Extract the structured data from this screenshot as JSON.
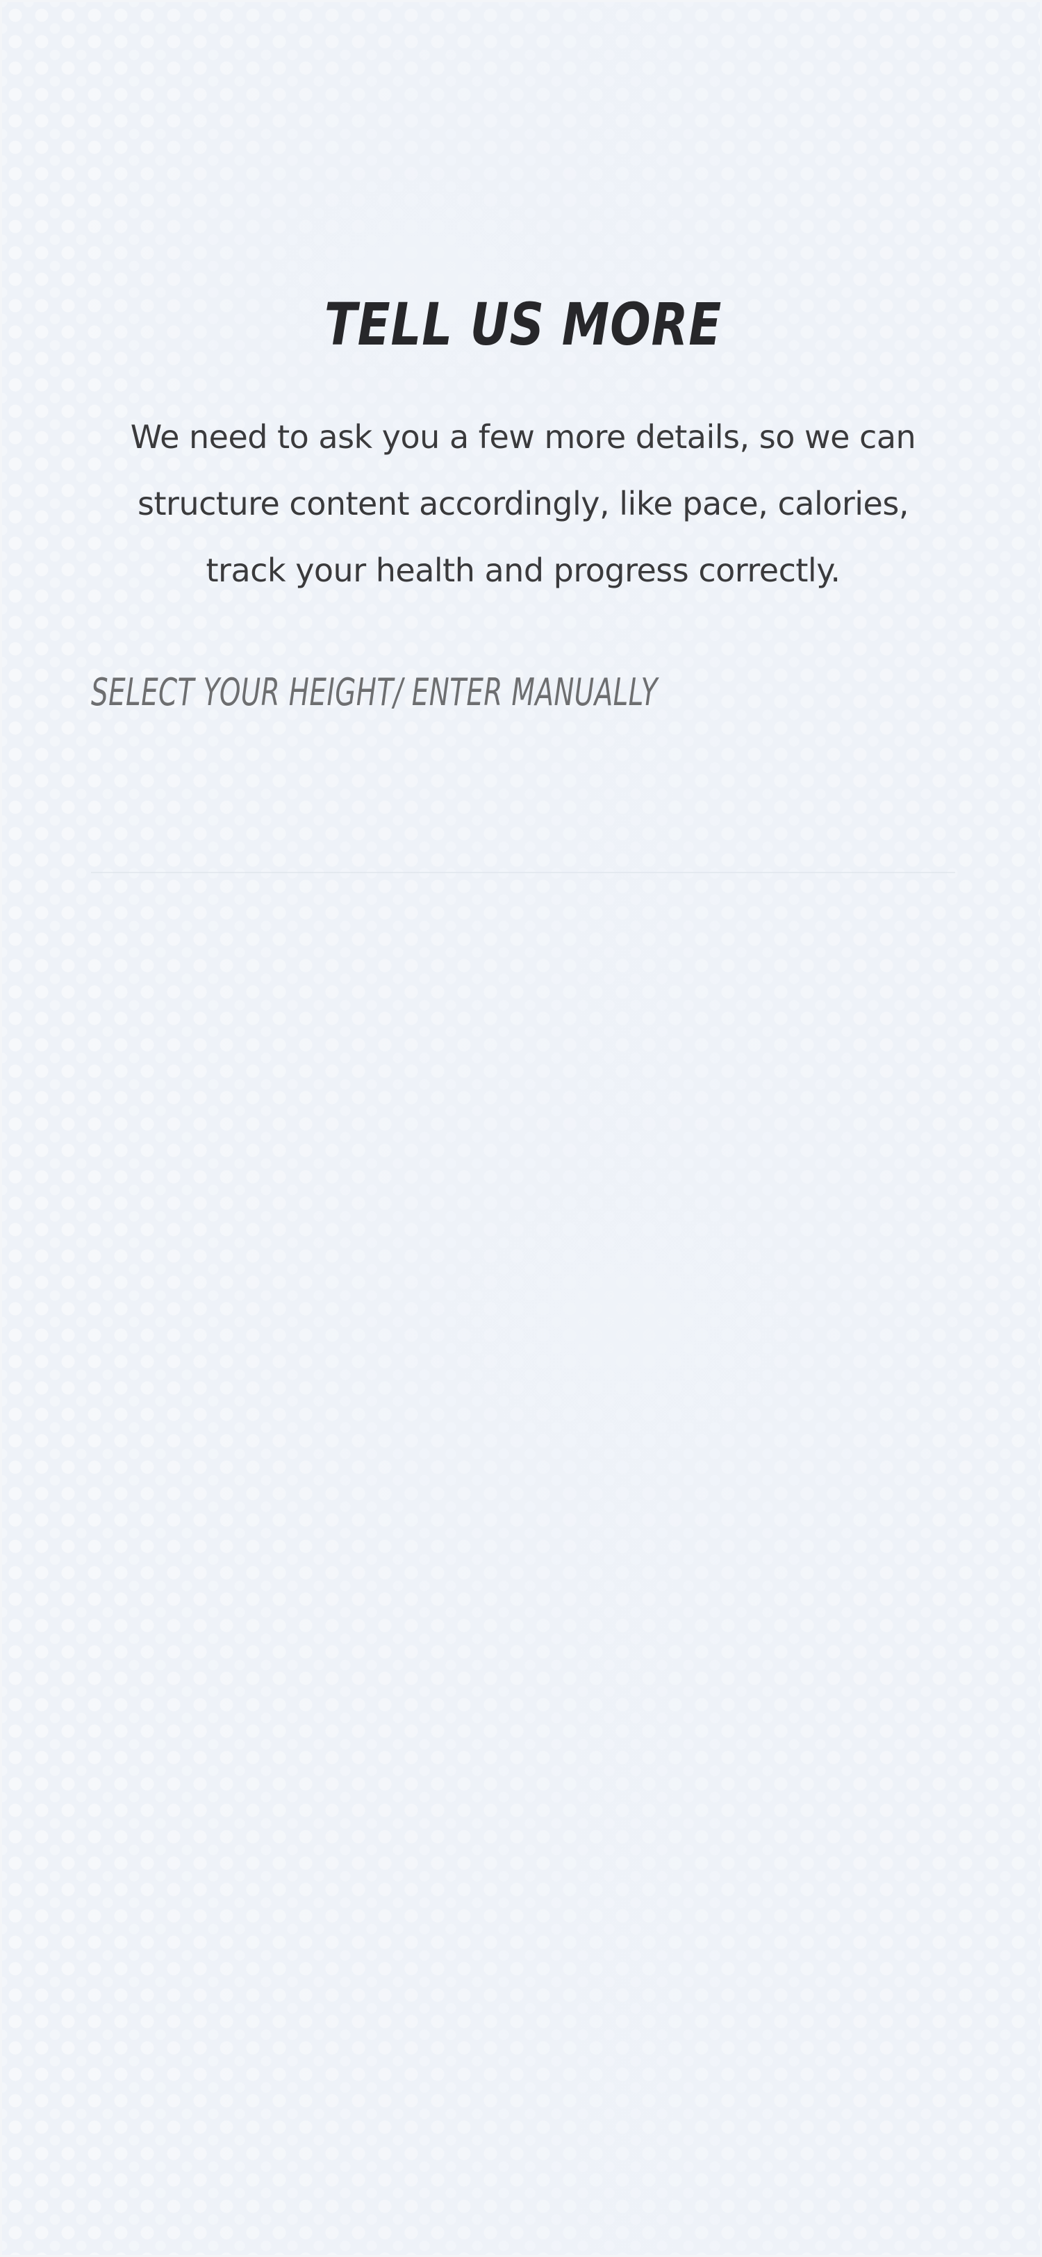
{
  "screen": {
    "title": "TELL US MORE",
    "description": "We need to ask you a few more details, so we can structure content  accordingly, like pace, calories, track your health and progress correctly.",
    "height_field": {
      "label": "SELECT YOUR HEIGHT/ ENTER MANUALLY"
    }
  },
  "colors": {
    "background": "#eef2f8",
    "title": "#27272a",
    "body_text": "#3a3a3c",
    "label": "#6d6e70"
  }
}
